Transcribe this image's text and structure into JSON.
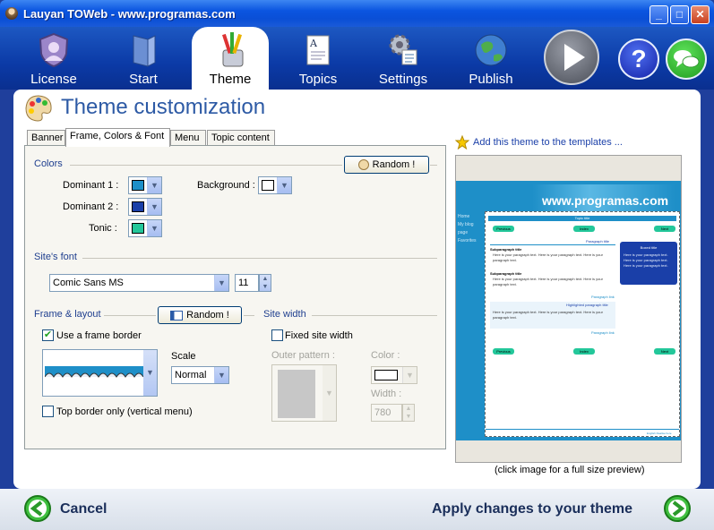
{
  "window": {
    "title": "Lauyan TOWeb - www.programas.com",
    "min_label": "_",
    "max_label": "□",
    "close_label": "✕"
  },
  "toolbar": {
    "items": [
      {
        "label": "License",
        "icon": "shield-user-icon"
      },
      {
        "label": "Start",
        "icon": "book-icon"
      },
      {
        "label": "Theme",
        "icon": "paint-brushes-icon",
        "active": true
      },
      {
        "label": "Topics",
        "icon": "document-icon"
      },
      {
        "label": "Settings",
        "icon": "gear-list-icon"
      },
      {
        "label": "Publish",
        "icon": "globe-icon"
      }
    ],
    "play_icon": "play-icon",
    "help_label": "?",
    "help_icon": "help-icon",
    "chat_icon": "chat-icon"
  },
  "page": {
    "title": "Theme customization",
    "title_icon": "palette-icon"
  },
  "tabs": [
    "Banner",
    "Frame, Colors & Font",
    "Menu",
    "Topic content"
  ],
  "colors": {
    "section": "Colors",
    "random_label": "Random !",
    "dominant1_label": "Dominant 1 :",
    "dominant1_color": "#1e8fc8",
    "dominant2_label": "Dominant 2 :",
    "dominant2_color": "#1a3fa8",
    "tonic_label": "Tonic :",
    "tonic_color": "#23c79a",
    "background_label": "Background :",
    "background_color": "#ffffff"
  },
  "font": {
    "section": "Site's font",
    "family": "Comic Sans MS",
    "size": "11"
  },
  "frame": {
    "section": "Frame & layout",
    "random_label": "Random !",
    "use_frame_label": "Use a frame border",
    "use_frame_checked": true,
    "scale_label": "Scale",
    "scale_value": "Normal",
    "top_border_label": "Top border only (vertical menu)",
    "top_border_checked": false
  },
  "site_width": {
    "section": "Site width",
    "fixed_label": "Fixed site width",
    "fixed_checked": false,
    "outer_pattern_label": "Outer pattern :",
    "color_label": "Color :",
    "width_label": "Width :",
    "width_value": "780"
  },
  "templates": {
    "add_label": "Add this theme to the templates ..."
  },
  "preview": {
    "banner_text": "www.programas.com",
    "menu": [
      "Home",
      "My blog page",
      "Favorites"
    ],
    "page_title": "Topic title",
    "nav_prev": "Previous",
    "nav_index": "Index",
    "nav_next": "Next",
    "paragraph_title": "Paragraph title",
    "subparagraph_title": "Subparagraph title",
    "body_text": "Here is your paragraph text. Here is your paragraph text. Here is your paragraph text.",
    "paragraph_link": "Paragraph link",
    "highlighted_title": "Highlighted paragraph title",
    "box_title": "Boxed title",
    "box_text": "Here is your paragraph text. Here is your paragraph text. Here is your paragraph text.",
    "footer": "English Realise here",
    "caption": "(click image for a full size preview)"
  },
  "footer": {
    "cancel_label": "Cancel",
    "apply_label": "Apply changes to your theme"
  }
}
